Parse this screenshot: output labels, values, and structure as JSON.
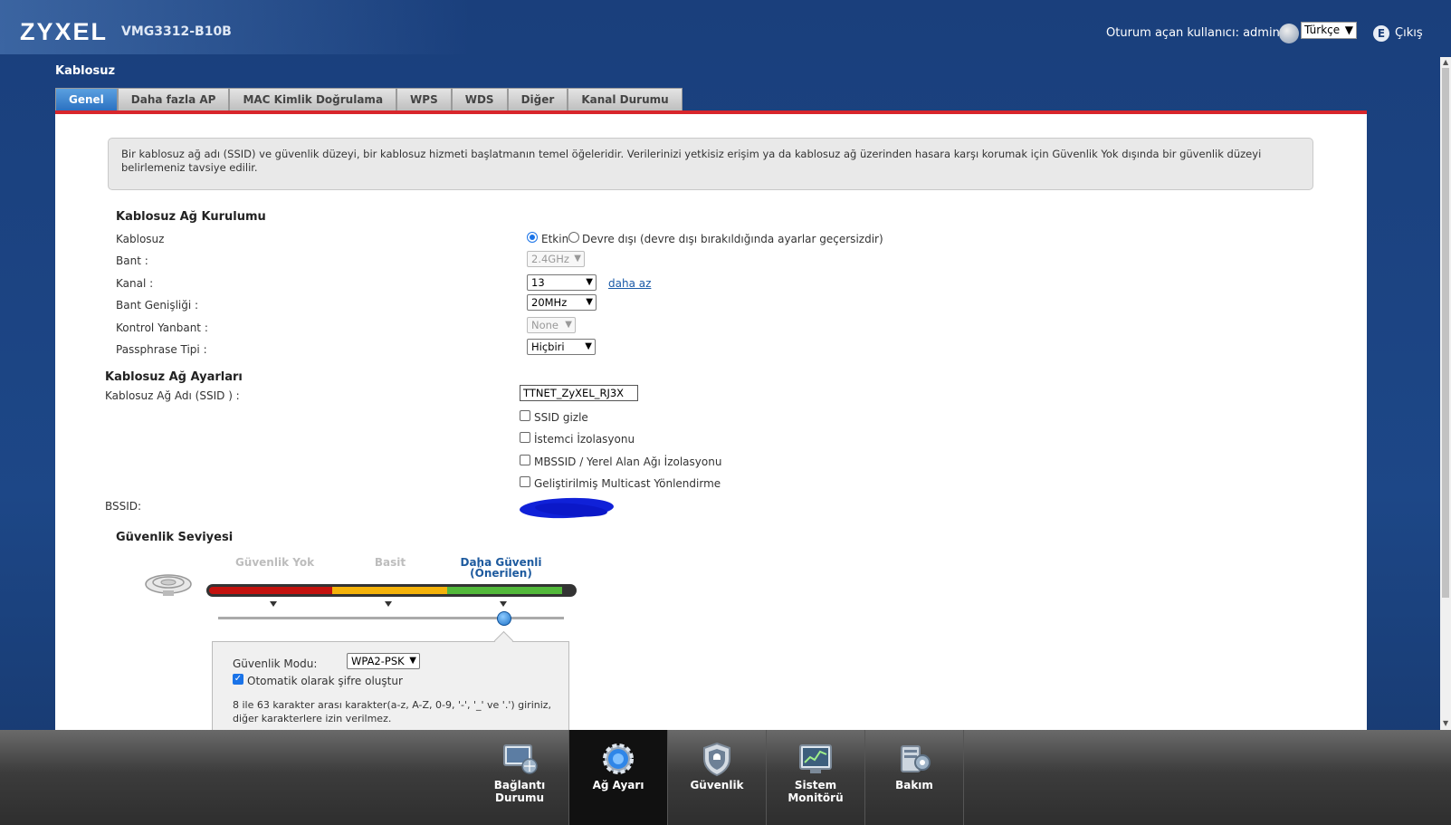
{
  "header": {
    "brand": "ZYXEL",
    "model": "VMG3312-B10B",
    "user_label": "Oturum açan kullanıcı:  admin",
    "language": "Türkçe",
    "logout": "Çıkış"
  },
  "section_title": "Kablosuz",
  "tabs": [
    "Genel",
    "Daha fazla AP",
    "MAC Kimlik Doğrulama",
    "WPS",
    "WDS",
    "Diğer",
    "Kanal Durumu"
  ],
  "info_text": "Bir kablosuz ağ adı (SSID) ve güvenlik düzeyi, bir kablosuz hizmeti başlatmanın temel öğeleridir. Verilerinizi yetkisiz erişim ya da kablosuz ağ üzerinden hasara karşı korumak için Güvenlik Yok dışında bir güvenlik düzeyi belirlemeniz tavsiye edilir.",
  "setup": {
    "title": "Kablosuz Ağ Kurulumu",
    "wireless_label": "Kablosuz",
    "enabled": "Etkin",
    "disabled": "Devre dışı (devre dışı bırakıldığında ayarlar geçersizdir)",
    "band_label": "Bant :",
    "band_value": "2.4GHz",
    "channel_label": "Kanal :",
    "channel_value": "13",
    "less_link": "daha az",
    "bandwidth_label": "Bant Genişliği :",
    "bandwidth_value": "20MHz",
    "sideband_label": "Kontrol Yanbant :",
    "sideband_value": "None",
    "passphrase_label": "Passphrase Tipi :",
    "passphrase_value": "Hiçbiri"
  },
  "network": {
    "title": "Kablosuz Ağ Ayarları",
    "ssid_label": "Kablosuz Ağ Adı (SSID ) :",
    "ssid_value": "TTNET_ZyXEL_RJ3X",
    "hide_ssid": "SSID gizle",
    "client_isolation": "İstemci İzolasyonu",
    "mbssid": "MBSSID / Yerel Alan Ağı İzolasyonu",
    "multicast": "Geliştirilmiş Multicast Yönlendirme",
    "bssid_label": "BSSID:"
  },
  "security": {
    "title": "Güvenlik Seviyesi",
    "level_none": "Güvenlik Yok",
    "level_basic": "Basit",
    "level_more_1": "Daha Güvenli",
    "level_more_2": "(Önerilen)",
    "selected_level": "Daha Güvenli",
    "mode_label": "Güvenlik Modu:",
    "mode_value": "WPA2-PSK",
    "auto_password": "Otomatik olarak şifre oluştur",
    "hint_1": "8 ile 63 karakter arası karakter(a-z, A-Z, 0-9, '-', '_' ve '.') giriniz,",
    "hint_2": "diğer karakterlere izin verilmez."
  },
  "dock": [
    {
      "label": "Bağlantı Durumu",
      "icon": "monitor-icon",
      "active": false
    },
    {
      "label": "Ağ Ayarı",
      "icon": "gear-icon",
      "active": true
    },
    {
      "label": "Güvenlik",
      "icon": "shield-icon",
      "active": false
    },
    {
      "label": "Sistem Monitörü",
      "icon": "chart-icon",
      "active": false
    },
    {
      "label": "Bakım",
      "icon": "tools-icon",
      "active": false
    }
  ],
  "colors": {
    "accent_red": "#d8262c",
    "tab_active": "#2a6fc0",
    "link": "#1a5aa8"
  }
}
